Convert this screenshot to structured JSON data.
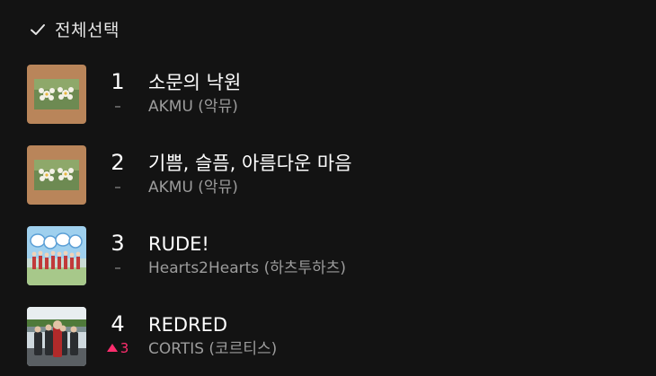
{
  "header": {
    "select_all_label": "전체선택"
  },
  "tracks": [
    {
      "rank": "1",
      "change": "–",
      "title": "소문의 낙원",
      "artist": "AKMU (악뮤)"
    },
    {
      "rank": "2",
      "change": "–",
      "title": "기쁨, 슬픔, 아름다운 마음",
      "artist": "AKMU (악뮤)"
    },
    {
      "rank": "3",
      "change": "–",
      "title": "RUDE!",
      "artist": "Hearts2Hearts (하츠투하츠)"
    },
    {
      "rank": "4",
      "change": "3",
      "change_direction": "up",
      "title": "REDRED",
      "artist": "CORTIS (코르티스)"
    }
  ],
  "colors": {
    "background": "#131313",
    "up": "#ff2e6e",
    "secondary_text": "#9c9c9c"
  }
}
